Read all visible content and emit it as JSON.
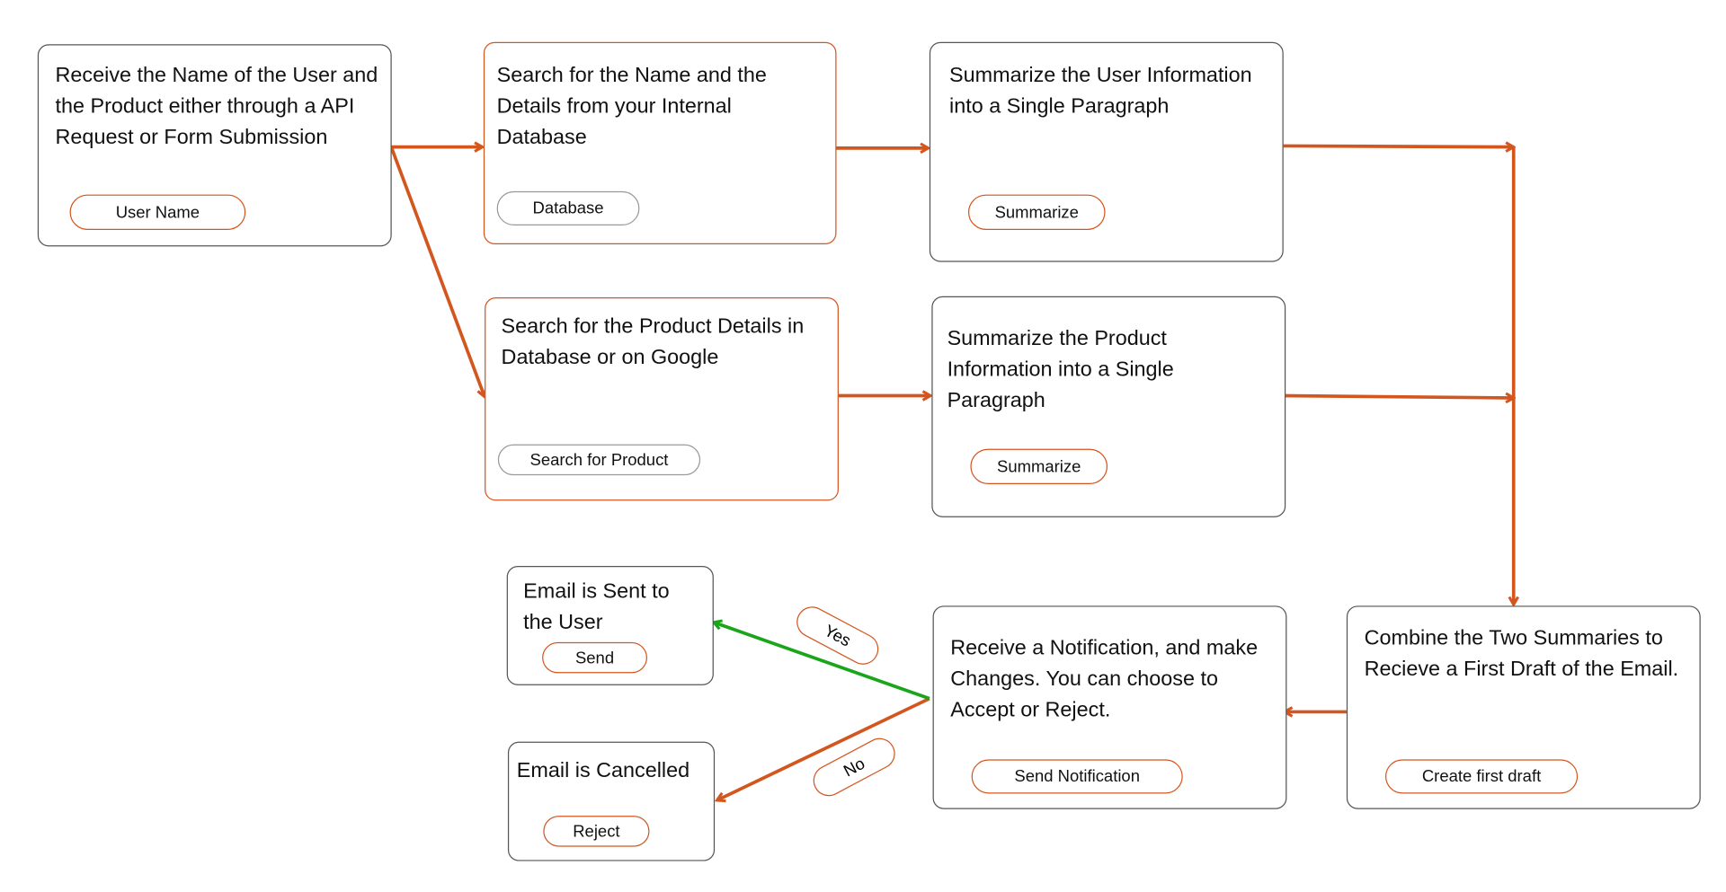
{
  "colors": {
    "accent": "#d4561f",
    "yes_arrow": "#1aa51a",
    "border": "#555555"
  },
  "nodes": {
    "receive": {
      "text": "Receive the Name of the User and the Product either through a API Request or Form Submission",
      "pill": "User Name"
    },
    "search_name": {
      "text": "Search for the Name and the Details from your Internal Database",
      "pill": "Database"
    },
    "summarize_user": {
      "text": "Summarize the User Information into a Single Paragraph",
      "pill": "Summarize"
    },
    "search_product": {
      "text": "Search for the Product Details in Database or on Google",
      "pill": "Search for Product"
    },
    "summarize_product": {
      "text": "Summarize the Product Information into a Single Paragraph",
      "pill": "Summarize"
    },
    "combine": {
      "text": "Combine the Two Summaries to Recieve a First Draft of the Email.",
      "pill": "Create first draft"
    },
    "notify": {
      "text": "Receive a Notification, and make Changes. You can choose to Accept or Reject.",
      "pill": "Send Notification"
    },
    "sent": {
      "text": "Email is Sent to the User",
      "pill": "Send"
    },
    "cancelled": {
      "text": "Email is Cancelled",
      "pill": "Reject"
    }
  },
  "edge_labels": {
    "yes": "Yes",
    "no": "No"
  }
}
